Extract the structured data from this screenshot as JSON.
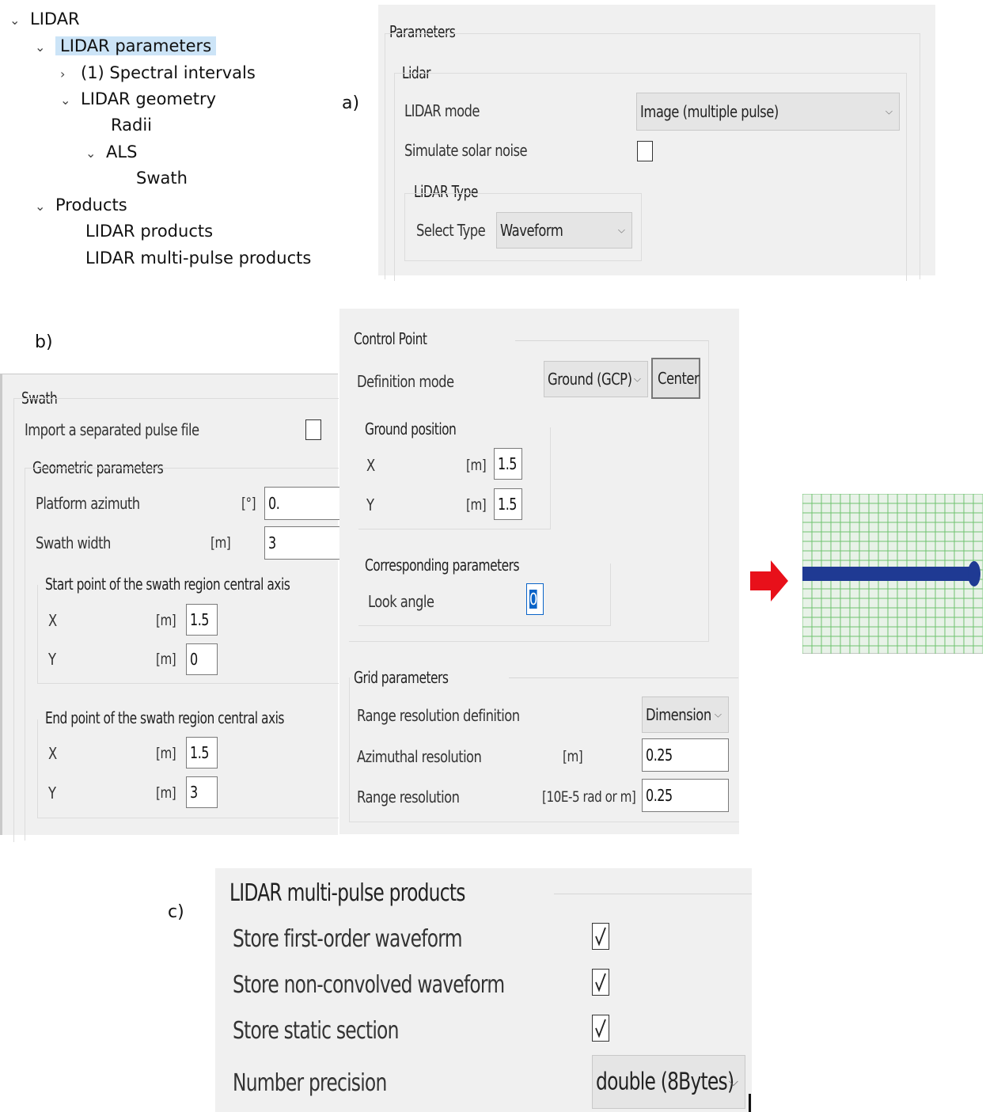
{
  "figure_labels": {
    "a": "a)",
    "b": "b)",
    "c": "c)"
  },
  "tree": {
    "items": [
      {
        "label": "LIDAR",
        "expanded": true
      },
      {
        "label": "LIDAR parameters",
        "expanded": true,
        "selected": true
      },
      {
        "label": "(1) Spectral intervals",
        "expanded": false
      },
      {
        "label": "LIDAR geometry",
        "expanded": true
      },
      {
        "label": "Radii"
      },
      {
        "label": "ALS",
        "expanded": true
      },
      {
        "label": "Swath"
      },
      {
        "label": "Products",
        "expanded": true
      },
      {
        "label": "LIDAR products"
      },
      {
        "label": "LIDAR multi-pulse products"
      }
    ]
  },
  "parameters": {
    "title": "Parameters",
    "lidar_group": "Lidar",
    "lidar_mode_label": "LIDAR mode",
    "lidar_mode_value": "Image (multiple pulse)",
    "solar_noise_label": "Simulate solar noise",
    "solar_noise_checked": false,
    "lidar_type_group": "LiDAR Type",
    "select_type_label": "Select Type",
    "select_type_value": "Waveform"
  },
  "swath": {
    "title": "Swath",
    "import_label": "Import a separated pulse file",
    "import_checked": false,
    "geom_group": "Geometric parameters",
    "platform_azimuth_label": "Platform azimuth",
    "platform_azimuth_unit": "[°]",
    "platform_azimuth_value": "0.",
    "swath_width_label": "Swath width",
    "swath_width_unit": "[m]",
    "swath_width_value": "3",
    "start_group": "Start point of the swath region central axis",
    "start_x_label": "X",
    "start_x_unit": "[m]",
    "start_x_value": "1.5",
    "start_y_label": "Y",
    "start_y_unit": "[m]",
    "start_y_value": "0",
    "end_group": "End point of the swath region central axis",
    "end_x_label": "X",
    "end_x_unit": "[m]",
    "end_x_value": "1.5",
    "end_y_label": "Y",
    "end_y_unit": "[m]",
    "end_y_value": "3"
  },
  "control_point": {
    "title": "Control Point",
    "definition_mode_label": "Definition mode",
    "definition_mode_value": "Ground (GCP)",
    "center_button": "Center",
    "ground_group": "Ground position",
    "gx_label": "X",
    "gx_unit": "[m]",
    "gx_value": "1.5",
    "gy_label": "Y",
    "gy_unit": "[m]",
    "gy_value": "1.5",
    "corr_group": "Corresponding parameters",
    "look_angle_label": "Look angle",
    "look_angle_value": "0"
  },
  "grid": {
    "title": "Grid parameters",
    "range_def_label": "Range resolution definition",
    "range_def_value": "Dimension",
    "azimuthal_label": "Azimuthal resolution",
    "azimuthal_unit": "[m]",
    "azimuthal_value": "0.25",
    "range_label": "Range resolution",
    "range_unit": "[10E-5 rad or m]",
    "range_value": "0.25"
  },
  "products": {
    "title": "LIDAR multi-pulse products",
    "first_order_label": "Store first-order waveform",
    "first_order_checked": true,
    "non_convolved_label": "Store non-convolved waveform",
    "non_convolved_checked": true,
    "static_section_label": "Store static section",
    "static_section_checked": true,
    "precision_label": "Number precision",
    "precision_value": "double (8Bytes)"
  },
  "colors": {
    "arrow": "#e8101a",
    "swath_band": "#1f3a93",
    "grid_line": "#6fc36f",
    "grid_bg": "#e8f2e8",
    "selection": "#cce4f7"
  },
  "icons": {
    "expanded": "chevron-down-icon",
    "collapsed": "chevron-right-icon",
    "dropdown": "chevron-down-icon",
    "check": "check-icon",
    "arrow": "arrow-right-icon"
  }
}
